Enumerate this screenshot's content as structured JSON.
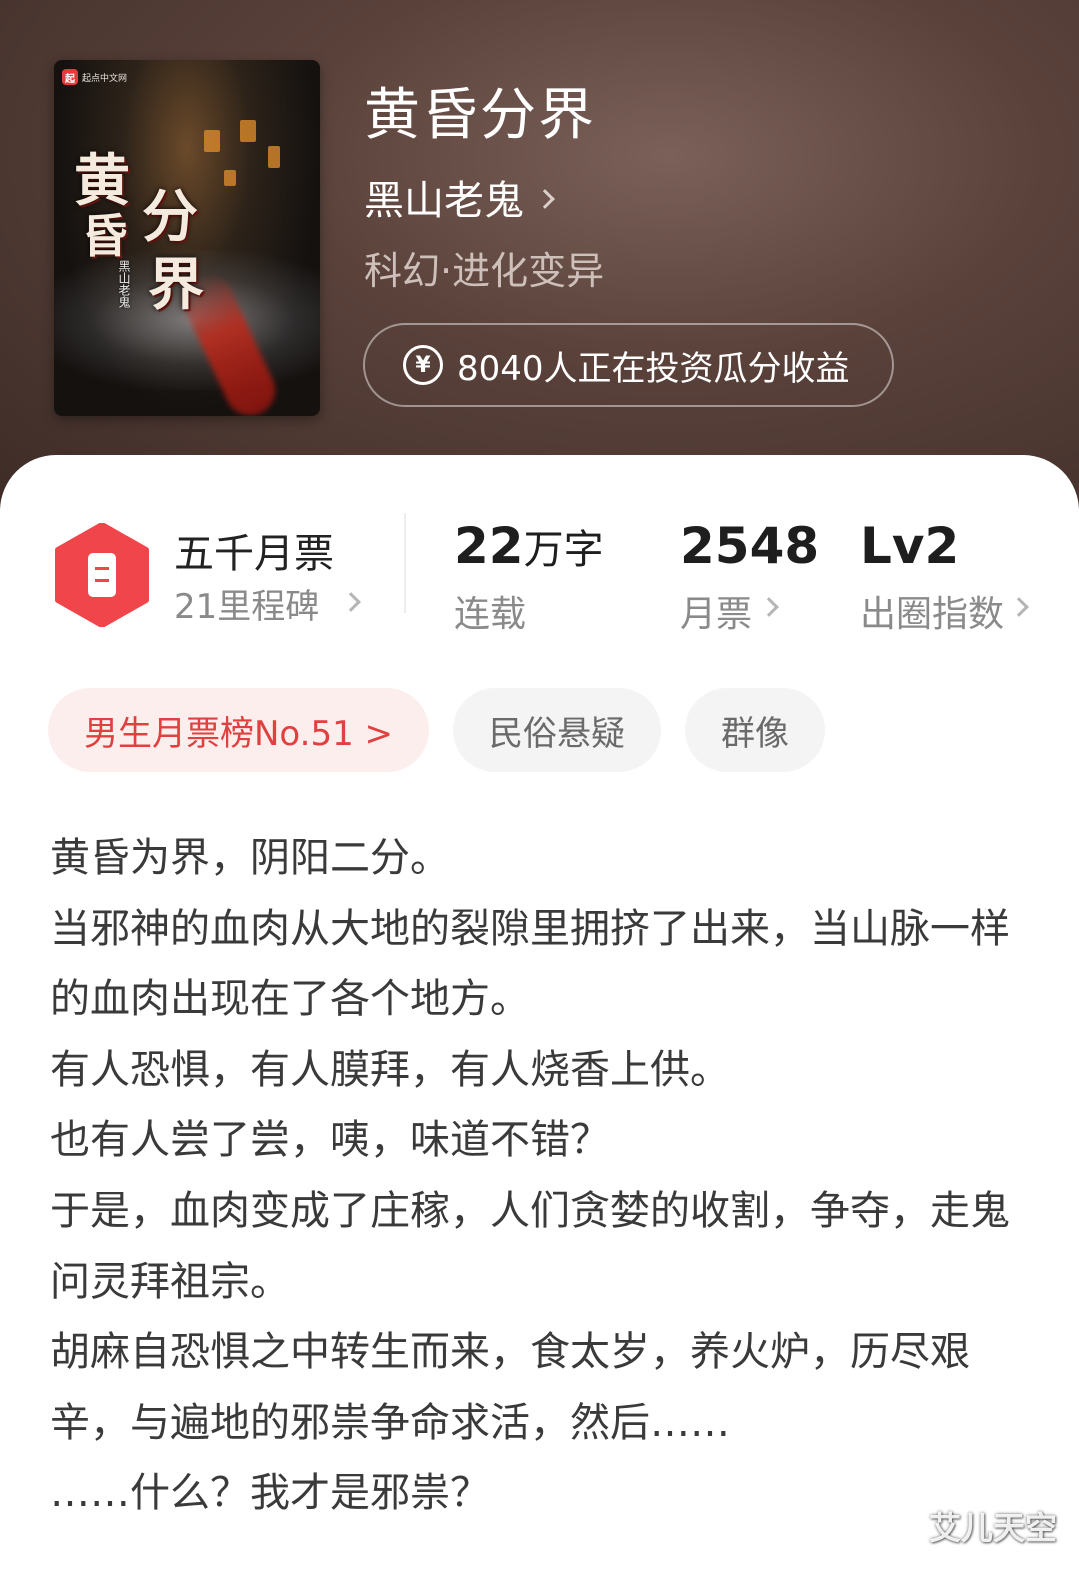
{
  "book": {
    "cover": {
      "publisher_logo": "起点中文网",
      "title_chars": [
        "黄",
        "昏",
        "分",
        "界"
      ],
      "author_vertical": "黑山老鬼"
    },
    "title": "黄昏分界",
    "author": "黑山老鬼",
    "genre": "科幻·进化变异",
    "invest_text": "8040人正在投资瓜分收益",
    "invest_icon": "yen-icon"
  },
  "stats": {
    "ticket": {
      "title": "五千月票",
      "subtitle": "21里程碑",
      "icon": "ticket-icon",
      "color": "#f0454a"
    },
    "words": {
      "number": "22",
      "unit": "万字",
      "label": "连载"
    },
    "monthly": {
      "value": "2548",
      "label": "月票"
    },
    "level": {
      "value": "Lv2",
      "label": "出圈指数"
    }
  },
  "tags": [
    {
      "label": "男生月票榜No.51 >",
      "style": "highlight",
      "color": "#e0413f"
    },
    {
      "label": "民俗悬疑",
      "style": "normal"
    },
    {
      "label": "群像",
      "style": "normal"
    }
  ],
  "synopsis": [
    "黄昏为界，阴阳二分。",
    "当邪神的血肉从大地的裂隙里拥挤了出来，当山脉一样的血肉出现在了各个地方。",
    "有人恐惧，有人膜拜，有人烧香上供。",
    "也有人尝了尝，咦，味道不错？",
    "于是，血肉变成了庄稼，人们贪婪的收割，争夺，走鬼问灵拜祖宗。",
    "胡麻自恐惧之中转生而来，食太岁，养火炉，历尽艰辛，与遍地的邪祟争命求活，然后……",
    "……什么？我才是邪祟？"
  ],
  "watermark": "艾儿天空"
}
